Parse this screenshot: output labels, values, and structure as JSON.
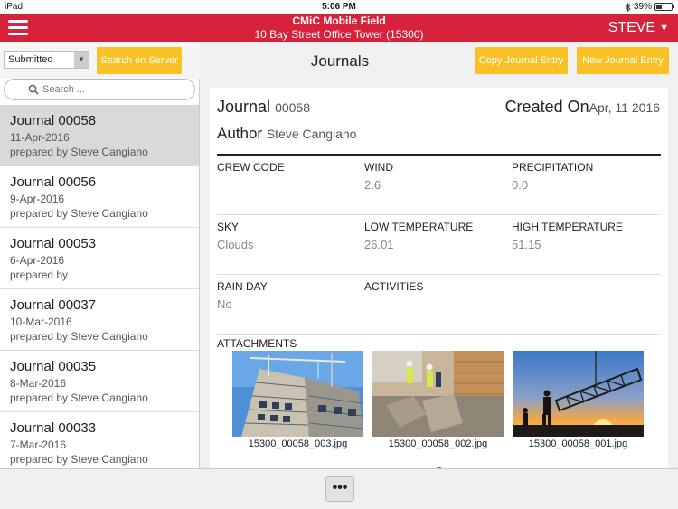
{
  "status_bar": {
    "device": "iPad",
    "time": "5:06 PM",
    "battery": "39%",
    "battery_level": 0.39
  },
  "header": {
    "title": "CMiC Mobile Field",
    "subtitle": "10 Bay Street Office Tower (15300)",
    "user": "STEVE"
  },
  "toolbar": {
    "status_filter": "Submitted",
    "search_server_label": "Search on Server",
    "page_title": "Journals",
    "copy_label": "Copy Journal Entry",
    "new_label": "New Journal Entry"
  },
  "search": {
    "placeholder": "Search ..."
  },
  "journals": [
    {
      "title": "Journal 00058",
      "date": "11-Apr-2016",
      "prepared": "prepared by Steve Cangiano",
      "selected": true
    },
    {
      "title": "Journal 00056",
      "date": "9-Apr-2016",
      "prepared": "prepared by Steve Cangiano"
    },
    {
      "title": "Journal 00053",
      "date": "6-Apr-2016",
      "prepared": "prepared by"
    },
    {
      "title": "Journal 00037",
      "date": "10-Mar-2016",
      "prepared": "prepared by Steve Cangiano"
    },
    {
      "title": "Journal 00035",
      "date": "8-Mar-2016",
      "prepared": "prepared by Steve Cangiano"
    },
    {
      "title": "Journal 00033",
      "date": "7-Mar-2016",
      "prepared": "prepared by Steve Cangiano"
    }
  ],
  "detail": {
    "journal_label": "Journal",
    "journal_number": "00058",
    "created_label": "Created On",
    "created_date": "Apr, 11 2016",
    "author_label": "Author",
    "author_name": "Steve Cangiano",
    "row1": {
      "crew_code_label": "CREW CODE",
      "crew_code_value": "",
      "wind_label": "WIND",
      "wind_value": "2.6",
      "precip_label": "PRECIPITATION",
      "precip_value": "0.0"
    },
    "row2": {
      "sky_label": "SKY",
      "sky_value": "Clouds",
      "low_label": "LOW TEMPERATURE",
      "low_value": "26.01",
      "high_label": "HIGH TEMPERATURE",
      "high_value": "51.15"
    },
    "row3": {
      "rain_label": "RAIN DAY",
      "rain_value": "No",
      "activities_label": "ACTIVITIES",
      "activities_value": ""
    },
    "attachments_label": "ATTACHMENTS",
    "attachments": [
      {
        "filename": "15300_00058_003.jpg"
      },
      {
        "filename": "15300_00058_002.jpg"
      },
      {
        "filename": "15300_00058_001.jpg"
      }
    ]
  },
  "bottom": {
    "more_label": "•••"
  },
  "colors": {
    "brand_red": "#d6223a",
    "accent_yellow": "#f9c126",
    "selected_row": "#d9d9d9"
  }
}
